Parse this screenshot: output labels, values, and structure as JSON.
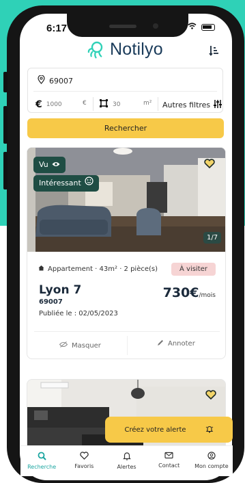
{
  "status": {
    "time": "6:17"
  },
  "header": {
    "logo_text": "Notilyo",
    "sort_icon": "sort-icon"
  },
  "search": {
    "location_value": "69007",
    "price_value": "1000",
    "price_unit": "€",
    "surface_value": "30",
    "surface_unit": "m²",
    "more_filters_label": "Autres filtres",
    "button_label": "Rechercher"
  },
  "listing": {
    "chips": {
      "seen_label": "Vu",
      "interest_label": "Intéressant"
    },
    "photo_counter": "1/7",
    "type_line": "Appartement · 43m² · 2 pièce(s)",
    "status_badge": "À visiter",
    "city": "Lyon 7",
    "zip": "69007",
    "published": "Publiée le : 02/05/2023",
    "price": "730€",
    "price_unit": "/mois",
    "hide_label": "Masquer",
    "annotate_label": "Annoter"
  },
  "alert": {
    "label": "Créez votre alerte"
  },
  "tabbar": {
    "items": [
      {
        "label": "Recherche",
        "icon": "search-icon",
        "active": true
      },
      {
        "label": "Favoris",
        "icon": "heart-icon",
        "active": false
      },
      {
        "label": "Alertes",
        "icon": "bell-icon",
        "active": false
      },
      {
        "label": "Contact",
        "icon": "mail-icon",
        "active": false
      },
      {
        "label": "Mon compte",
        "icon": "user-icon",
        "active": false
      }
    ]
  },
  "colors": {
    "brand_teal": "#2fd1b7",
    "accent_yellow": "#f7c948",
    "navy": "#1a3b5a",
    "chip_green": "#1f4d44"
  }
}
